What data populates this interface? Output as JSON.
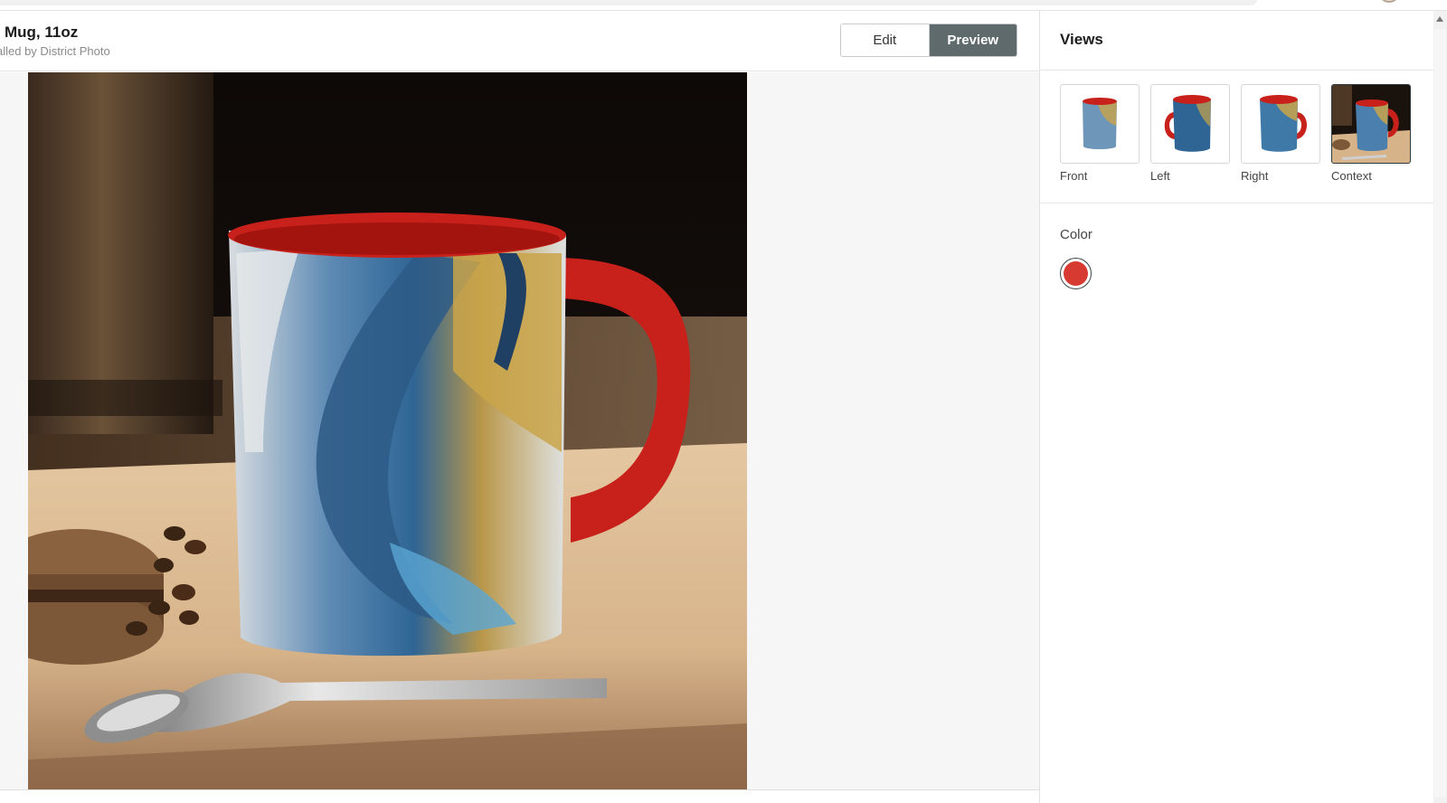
{
  "header": {
    "title": "Mug, 11oz",
    "subtitle": "alled by District Photo",
    "edit_label": "Edit",
    "preview_label": "Preview"
  },
  "panel": {
    "views_title": "Views",
    "views": [
      {
        "label": "Front",
        "selected": false
      },
      {
        "label": "Left",
        "selected": false
      },
      {
        "label": "Right",
        "selected": false
      },
      {
        "label": "Context",
        "selected": true
      }
    ],
    "color_title": "Color",
    "selected_color": "#d63a30"
  },
  "colors": {
    "mug_red": "#c8201b",
    "marble_blue": "#3f79a8",
    "gold": "#c9a44a",
    "toggle_active": "#5f6a6d"
  }
}
